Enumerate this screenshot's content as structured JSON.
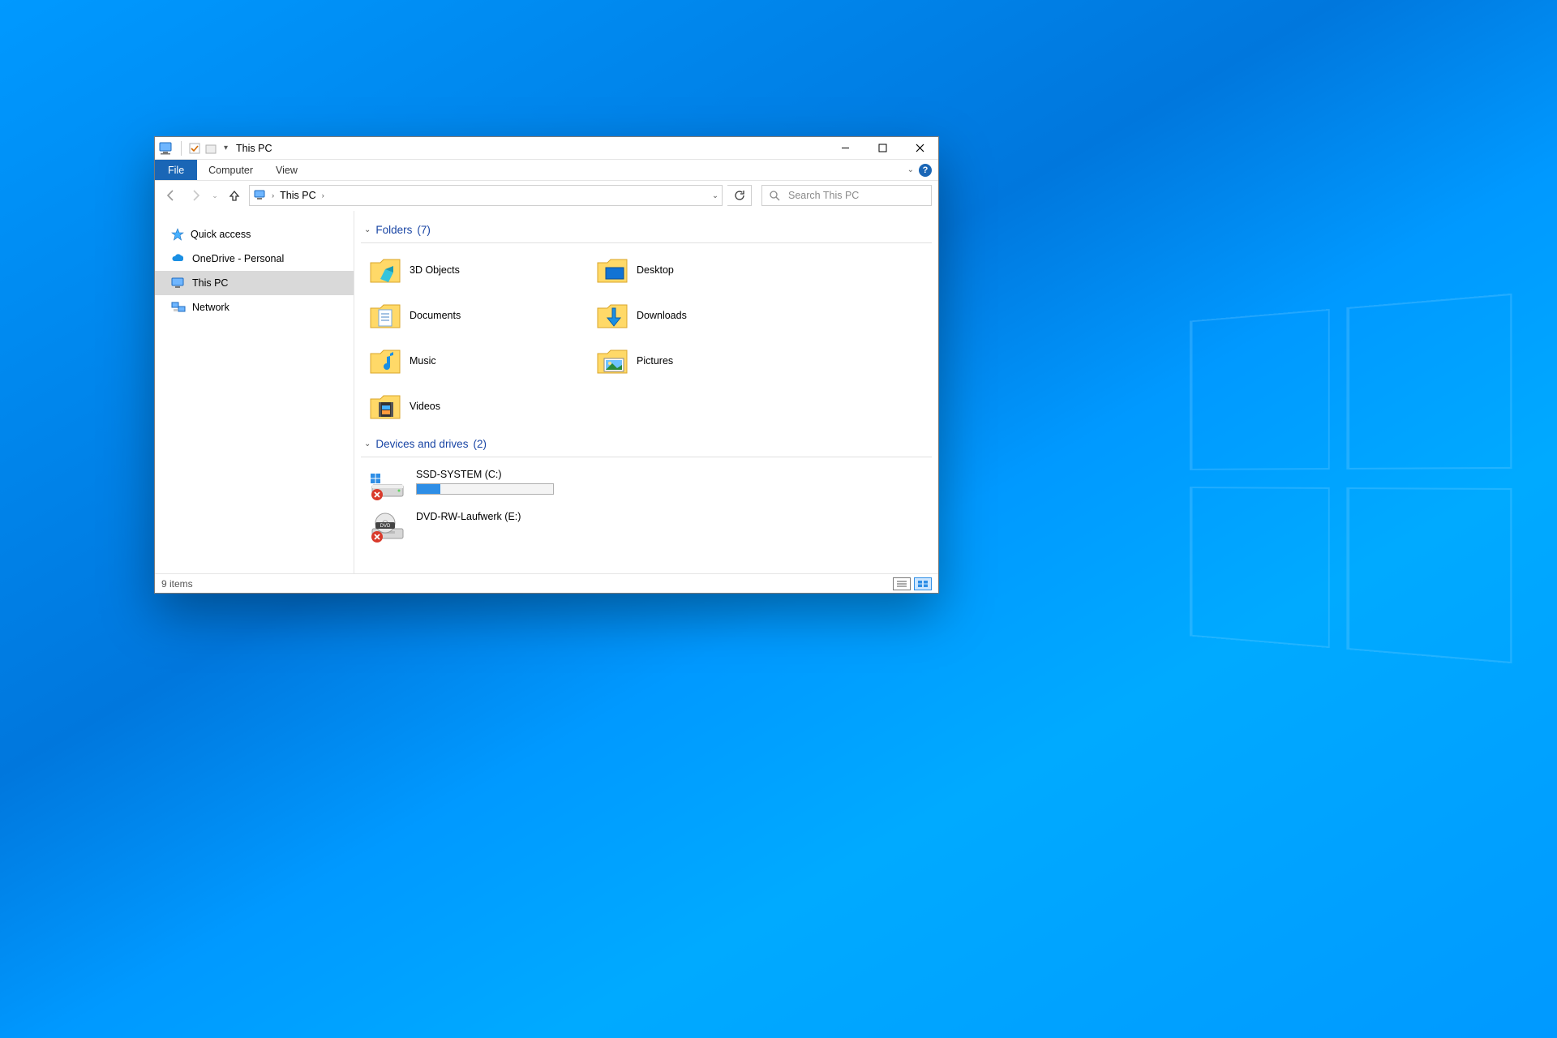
{
  "window": {
    "title": "This PC"
  },
  "ribbon": {
    "file": "File",
    "tabs": [
      "Computer",
      "View"
    ]
  },
  "nav": {
    "breadcrumb": [
      "This PC"
    ],
    "search_placeholder": "Search This PC"
  },
  "sidebar": {
    "items": [
      {
        "label": "Quick access",
        "icon": "star"
      },
      {
        "label": "OneDrive - Personal",
        "icon": "onedrive"
      },
      {
        "label": "This PC",
        "icon": "pc",
        "selected": true
      },
      {
        "label": "Network",
        "icon": "network"
      }
    ]
  },
  "groups": {
    "folders": {
      "title": "Folders",
      "count": "(7)",
      "items": [
        {
          "label": "3D Objects",
          "icon": "cube"
        },
        {
          "label": "Desktop",
          "icon": "desktop"
        },
        {
          "label": "Documents",
          "icon": "doc"
        },
        {
          "label": "Downloads",
          "icon": "download"
        },
        {
          "label": "Music",
          "icon": "music"
        },
        {
          "label": "Pictures",
          "icon": "pictures"
        },
        {
          "label": "Videos",
          "icon": "videos"
        }
      ]
    },
    "drives": {
      "title": "Devices and drives",
      "count": "(2)",
      "items": [
        {
          "label": "SSD-SYSTEM (C:)",
          "type": "hdd",
          "usage_pct": 17
        },
        {
          "label": "DVD-RW-Laufwerk (E:)",
          "type": "dvd"
        }
      ]
    }
  },
  "status": {
    "text": "9 items"
  }
}
